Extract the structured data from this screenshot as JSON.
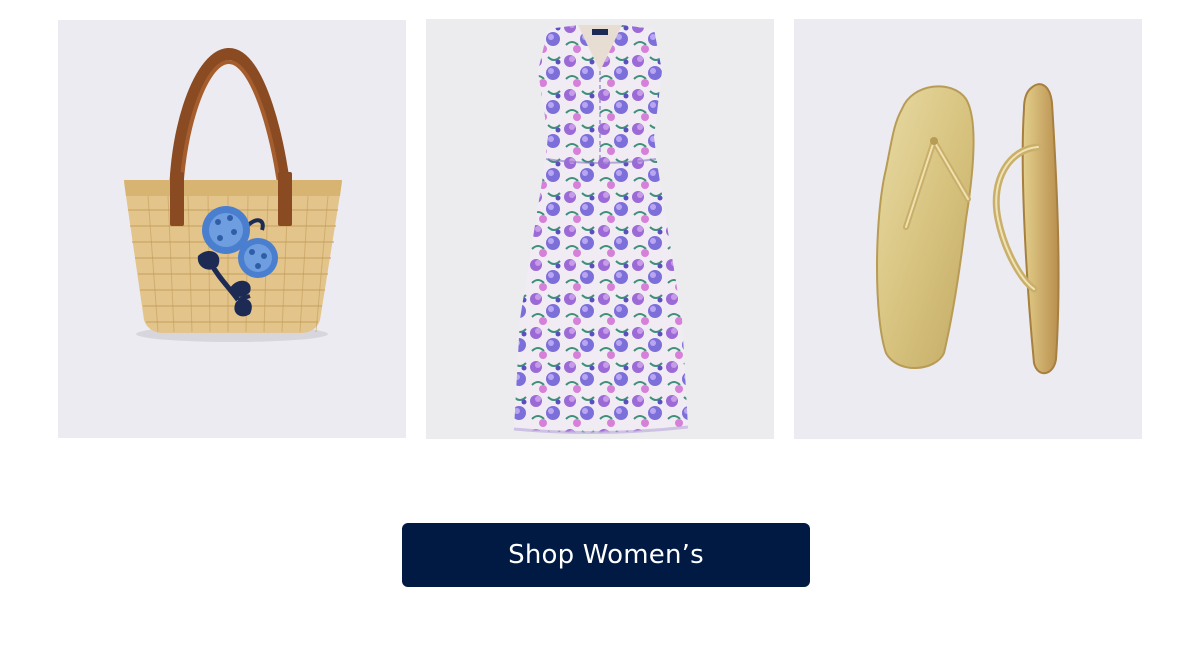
{
  "products": [
    {
      "name": "straw-tote-bag",
      "icon": "tote-bag-icon",
      "bg": "#ebebf1"
    },
    {
      "name": "floral-maxi-dress",
      "icon": "dress-icon",
      "bg": "#ececee"
    },
    {
      "name": "gold-flip-flops",
      "icon": "sandals-icon",
      "bg": "#ebebf1"
    }
  ],
  "cta": {
    "label": "Shop Women’s",
    "bg": "#001a44",
    "color": "#ffffff"
  }
}
